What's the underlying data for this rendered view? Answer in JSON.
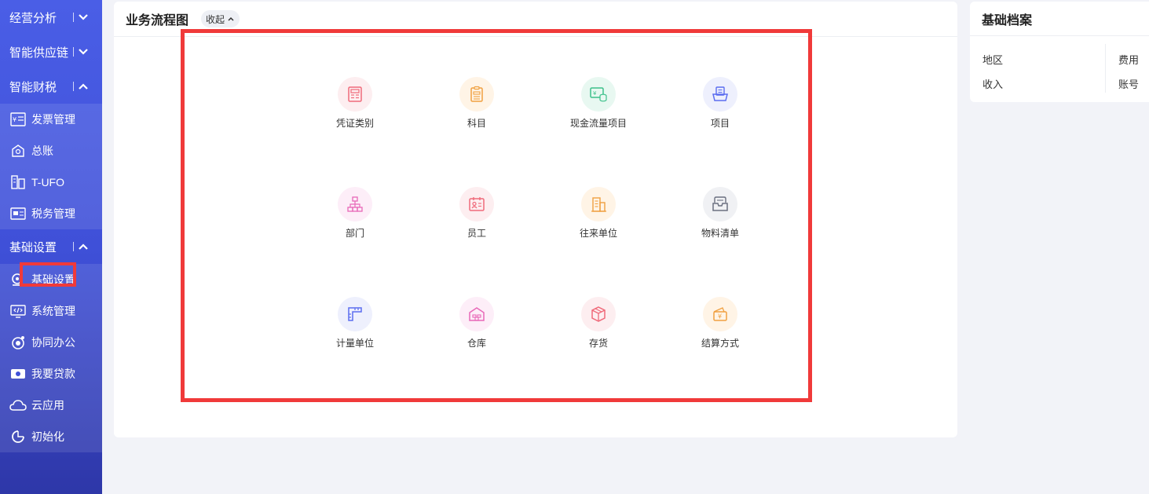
{
  "sidebar": {
    "groups": [
      {
        "label": "经营分析"
      },
      {
        "label": "智能供应链"
      },
      {
        "label": "智能财税"
      },
      {
        "label": "基础设置"
      }
    ],
    "finance_items": [
      {
        "label": "发票管理",
        "icon": "invoice-icon"
      },
      {
        "label": "总账",
        "icon": "ledger-icon"
      },
      {
        "label": "T-UFO",
        "icon": "report-icon"
      },
      {
        "label": "税务管理",
        "icon": "tax-icon"
      }
    ],
    "settings_items": [
      {
        "label": "基础设置",
        "icon": "settings-icon"
      },
      {
        "label": "系统管理",
        "icon": "system-icon"
      },
      {
        "label": "协同办公",
        "icon": "collab-icon"
      },
      {
        "label": "我要贷款",
        "icon": "loan-icon"
      },
      {
        "label": "云应用",
        "icon": "cloud-icon"
      },
      {
        "label": "初始化",
        "icon": "init-icon"
      }
    ]
  },
  "main": {
    "title": "业务流程图",
    "collapse_label": "收起",
    "tiles": [
      {
        "label": "凭证类别",
        "icon": "voucher-icon",
        "color": "#f06a7a",
        "bg": "#fdeef0"
      },
      {
        "label": "科目",
        "icon": "subject-icon",
        "color": "#f0a040",
        "bg": "#fff4e6"
      },
      {
        "label": "现金流量项目",
        "icon": "cashflow-icon",
        "color": "#3cc08a",
        "bg": "#e8f8f1"
      },
      {
        "label": "项目",
        "icon": "project-icon",
        "color": "#5b6df0",
        "bg": "#eef0fd"
      },
      {
        "label": "部门",
        "icon": "department-icon",
        "color": "#e868b8",
        "bg": "#fdeef8"
      },
      {
        "label": "员工",
        "icon": "employee-icon",
        "color": "#f06a7a",
        "bg": "#fdeef0"
      },
      {
        "label": "往来单位",
        "icon": "partner-icon",
        "color": "#f0a040",
        "bg": "#fff4e6"
      },
      {
        "label": "物料清单",
        "icon": "bom-icon",
        "color": "#6b7080",
        "bg": "#f0f1f4"
      },
      {
        "label": "计量单位",
        "icon": "unit-icon",
        "color": "#5b6df0",
        "bg": "#eef0fd"
      },
      {
        "label": "仓库",
        "icon": "warehouse-icon",
        "color": "#e868b8",
        "bg": "#fdeef8"
      },
      {
        "label": "存货",
        "icon": "inventory-icon",
        "color": "#f06a7a",
        "bg": "#fdeef0"
      },
      {
        "label": "结算方式",
        "icon": "settlement-icon",
        "color": "#f0a040",
        "bg": "#fff4e6"
      }
    ]
  },
  "right_panel": {
    "title": "基础档案",
    "items": [
      "地区",
      "费用",
      "收入",
      "账号"
    ]
  }
}
